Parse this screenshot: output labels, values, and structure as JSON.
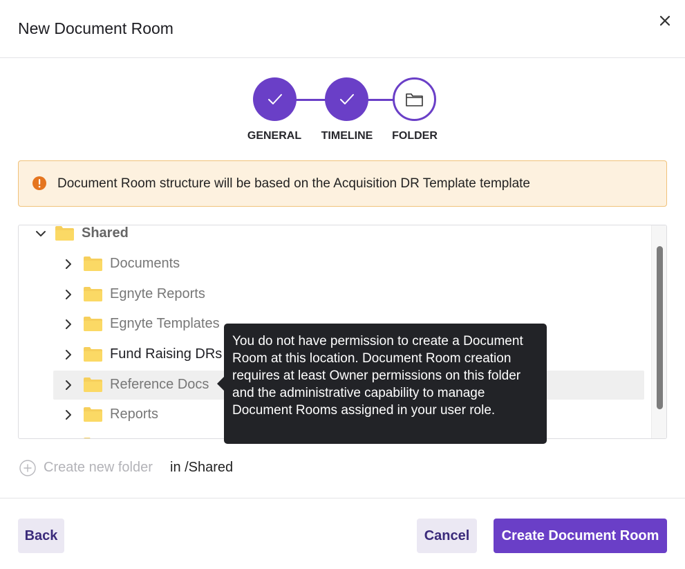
{
  "dialog": {
    "title": "New Document Room",
    "close_icon": "close-icon"
  },
  "stepper": {
    "steps": [
      {
        "label": "GENERAL",
        "state": "done",
        "icon": "check-icon"
      },
      {
        "label": "TIMELINE",
        "state": "done",
        "icon": "check-icon"
      },
      {
        "label": "FOLDER",
        "state": "current",
        "icon": "folder-icon"
      }
    ],
    "accent": "#6a3fc7"
  },
  "alert": {
    "icon": "warning-icon",
    "text": "Document Room structure will be based on the Acquisition DR Template template"
  },
  "tree": {
    "root": {
      "label": "Shared",
      "expanded": true
    },
    "children": [
      {
        "label": "Documents"
      },
      {
        "label": "Egnyte Reports"
      },
      {
        "label": "Egnyte Templates"
      },
      {
        "label": "Fund Raising DRs"
      },
      {
        "label": "Reference Docs",
        "selected": true
      },
      {
        "label": "Reports"
      }
    ]
  },
  "tooltip": {
    "text": "You do not have permission to create a Document Room at this location. Document Room creation requires at least Owner permissions on this folder and the administrative capability to manage Document Rooms assigned in your user role."
  },
  "create_folder": {
    "link_label": "Create new folder",
    "path_label": "in /Shared"
  },
  "footer": {
    "back_label": "Back",
    "cancel_label": "Cancel",
    "create_label": "Create Document Room"
  }
}
